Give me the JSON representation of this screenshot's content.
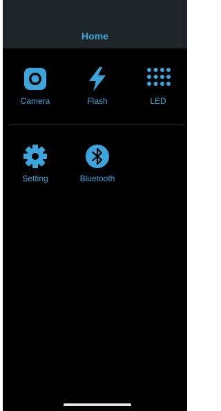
{
  "header": {
    "title": "Home"
  },
  "menu": {
    "row1": [
      {
        "label": "Camera",
        "icon": "camera-icon"
      },
      {
        "label": "Flash",
        "icon": "flash-icon"
      },
      {
        "label": "LED",
        "icon": "led-grid-icon"
      }
    ],
    "row2": [
      {
        "label": "Setting",
        "icon": "gear-icon"
      },
      {
        "label": "Bluetooth",
        "icon": "bluetooth-icon"
      }
    ]
  },
  "colors": {
    "accent": "#3aa6db",
    "background": "#000000",
    "header": "#1d2528"
  }
}
